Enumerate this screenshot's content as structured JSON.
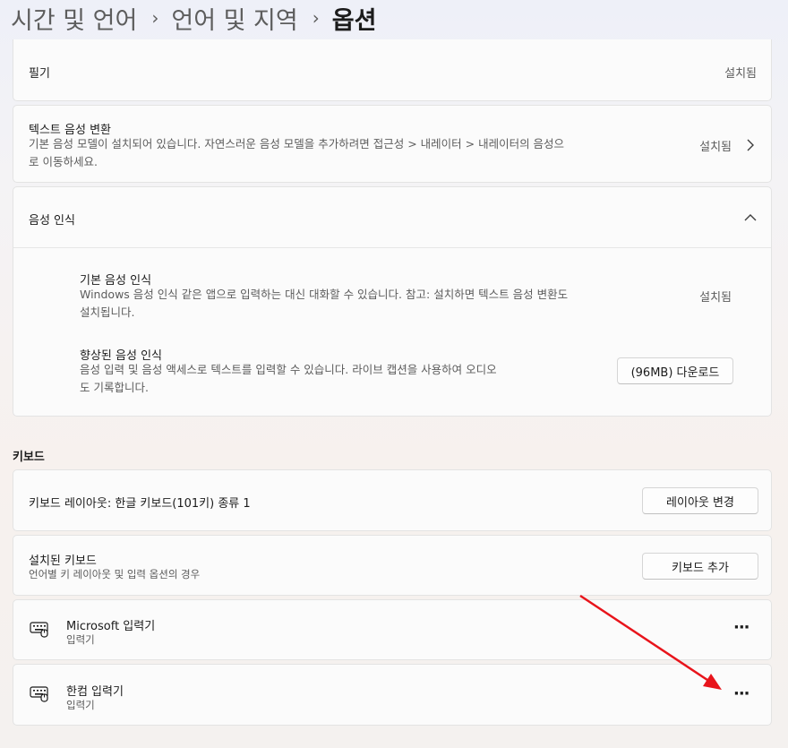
{
  "breadcrumb": {
    "items": [
      "시간 및 언어",
      "언어 및 지역"
    ],
    "current": "옵션",
    "separator": "›"
  },
  "handwriting": {
    "title": "필기",
    "status": "설치됨"
  },
  "tts": {
    "title": "텍스트 음성 변환",
    "description_line1": "기본 음성 모델이 설치되어 있습니다. 자연스러운 음성 모델을 추가하려면 접근성 > 내레이터 > 내레이터의 음성으",
    "description_line2": "로 이동하세요.",
    "status": "설치됨",
    "chevron_icon": "chevron-right-icon"
  },
  "speech": {
    "title": "음성 인식",
    "chevron_icon": "chevron-up-icon",
    "basic": {
      "title": "기본 음성 인식",
      "description_line1": "Windows 음성 인식 같은 앱으로 입력하는 대신 대화할 수 있습니다. 참고: 설치하면 텍스트 음성 변환도",
      "description_line2": "설치됩니다.",
      "status": "설치됨"
    },
    "enhanced": {
      "title": "향상된 음성 인식",
      "description_line1": "음성 입력 및 음성 액세스로 텍스트를 입력할 수 있습니다. 라이브 캡션을 사용하여 오디오",
      "description_line2": "도 기록합니다.",
      "button_label": "(96MB) 다운로드"
    }
  },
  "keyboard": {
    "section_label": "키보드",
    "layout": {
      "title": "키보드 레이아웃: 한글 키보드(101키) 종류 1",
      "button_label": "레이아웃 변경"
    },
    "installed": {
      "title": "설치된 키보드",
      "subtitle": "언어별 키 레이아웃 및 입력 옵션의 경우",
      "button_label": "키보드 추가"
    },
    "ime_items": [
      {
        "title": "Microsoft 입력기",
        "subtitle": "입력기",
        "icon": "keyboard-icon",
        "more": "···"
      },
      {
        "title": "한컴 입력기",
        "subtitle": "입력기",
        "icon": "keyboard-icon",
        "more": "···"
      }
    ]
  },
  "annotation": {
    "arrow_color": "#e8141b"
  },
  "colors": {
    "background": "#f3f3f3",
    "card": "#fbfbfb",
    "border": "#e3e3e3"
  }
}
